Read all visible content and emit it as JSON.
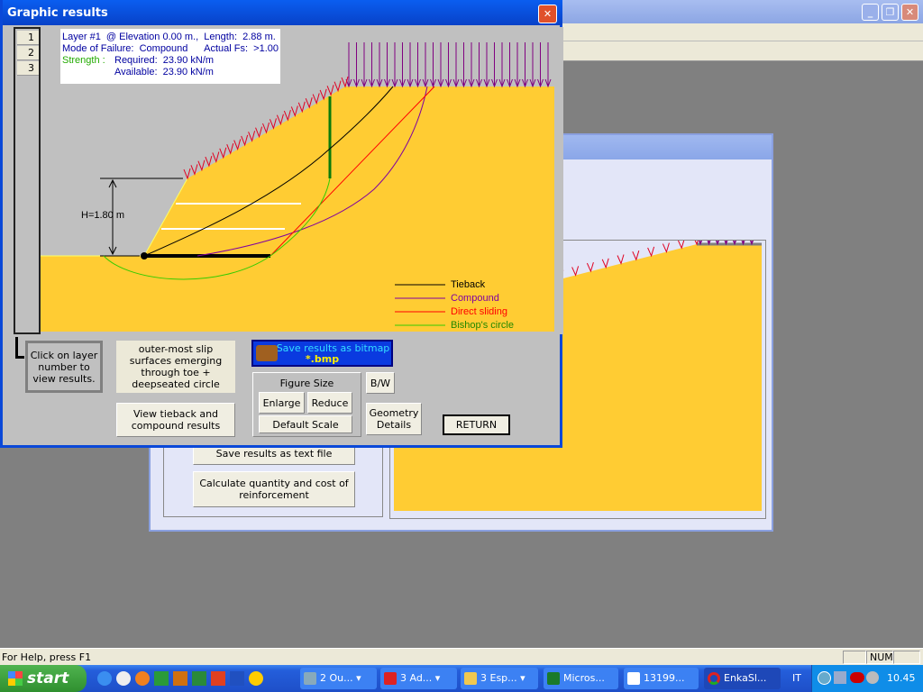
{
  "app": {
    "window_buttons": [
      "minimize",
      "restore",
      "close"
    ]
  },
  "statusbar": {
    "help": "For Help, press F1",
    "num": "NUM"
  },
  "taskbar": {
    "start": "start",
    "items": [
      {
        "label": "2 Ou...",
        "icon": "outlook-icon"
      },
      {
        "label": "3 Ad...",
        "icon": "acrobat-icon"
      },
      {
        "label": "3 Esp...",
        "icon": "folder-icon"
      },
      {
        "label": "Micros...",
        "icon": "excel-icon"
      },
      {
        "label": "13199...",
        "icon": "word-icon"
      },
      {
        "label": "EnkaSl...",
        "icon": "enkaslope-icon"
      }
    ],
    "lang": "IT",
    "clock": "10.45"
  },
  "bg_dialog": {
    "save_text": "Save results as text file",
    "calc_cost": "Calculate quantity and cost of reinforcement"
  },
  "dialog": {
    "title": "Graphic results",
    "layers": [
      "1",
      "2",
      "3"
    ],
    "info": {
      "line1": "Layer #1  @ Elevation 0.00 m.,  Length:  2.88 m.",
      "line2": "Mode of Failure:  Compound      Actual Fs:  >1.00",
      "strength_label": "Strength :",
      "required": "Required:  23.90 kN/m",
      "available": "Available:  23.90 kN/m"
    },
    "height_label": "H=1.80 m",
    "legend": [
      {
        "label": "Tieback",
        "color": "#000000"
      },
      {
        "label": "Compound",
        "color": "#8000a0"
      },
      {
        "label": "Direct sliding",
        "color": "#ff0000"
      },
      {
        "label": "Bishop's circle",
        "color": "#33cc00"
      }
    ],
    "colors": {
      "soil": "#ffcc33",
      "sky": "#c0c0c0",
      "surcharge": "#800080",
      "facing": "#e00020",
      "reinforcement": "#ffffff"
    },
    "click_layer_note": "Click on layer number to view results.",
    "slip_note": "outer-most slip surfaces emerging through toe + deepseated circle",
    "view_tieback": "View tieback and compound results",
    "save_bitmap": "Save results as bitmap",
    "save_bitmap_ext": "*.bmp",
    "figure_size": "Figure Size",
    "enlarge": "Enlarge",
    "reduce": "Reduce",
    "default_scale": "Default Scale",
    "bw": "B/W",
    "geometry": "Geometry Details",
    "return": "RETURN"
  }
}
